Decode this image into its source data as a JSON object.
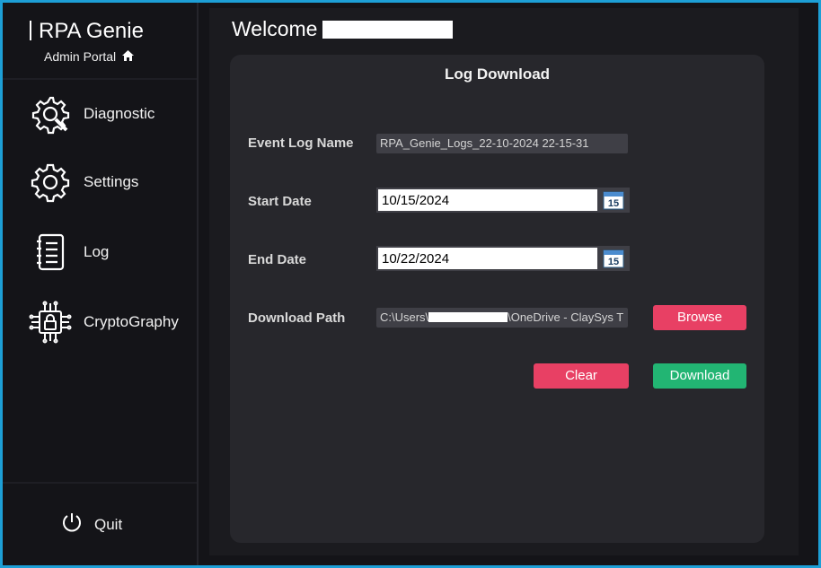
{
  "brand": {
    "title": "RPA Genie",
    "subtitle": "Admin Portal",
    "home_icon": "home-icon"
  },
  "sidebar": {
    "items": [
      {
        "label": "Diagnostic",
        "icon": "diagnostic-gear-wrench-icon"
      },
      {
        "label": "Settings",
        "icon": "gear-icon"
      },
      {
        "label": "Log",
        "icon": "document-list-icon"
      },
      {
        "label": "CryptoGraphy",
        "icon": "circuit-lock-icon"
      }
    ],
    "quit_label": "Quit",
    "quit_icon": "power-icon"
  },
  "main": {
    "welcome": "Welcome",
    "card": {
      "title": "Log Download",
      "event_log_name_label": "Event Log Name",
      "event_log_name_value": "RPA_Genie_Logs_22-10-2024 22-15-31",
      "start_date_label": "Start Date",
      "start_date_value": "10/15/2024",
      "end_date_label": "End Date",
      "end_date_value": "10/22/2024",
      "calendar_day": "15",
      "download_path_label": "Download Path",
      "download_path_prefix": "C:\\Users\\",
      "download_path_suffix": "\\OneDrive - ClaySys T",
      "browse_label": "Browse",
      "clear_label": "Clear",
      "download_label": "Download"
    }
  },
  "colors": {
    "frame_border": "#1d9fd6",
    "background": "#141418",
    "card": "#27272c",
    "accent_red": "#e84064",
    "accent_green": "#22b573"
  }
}
